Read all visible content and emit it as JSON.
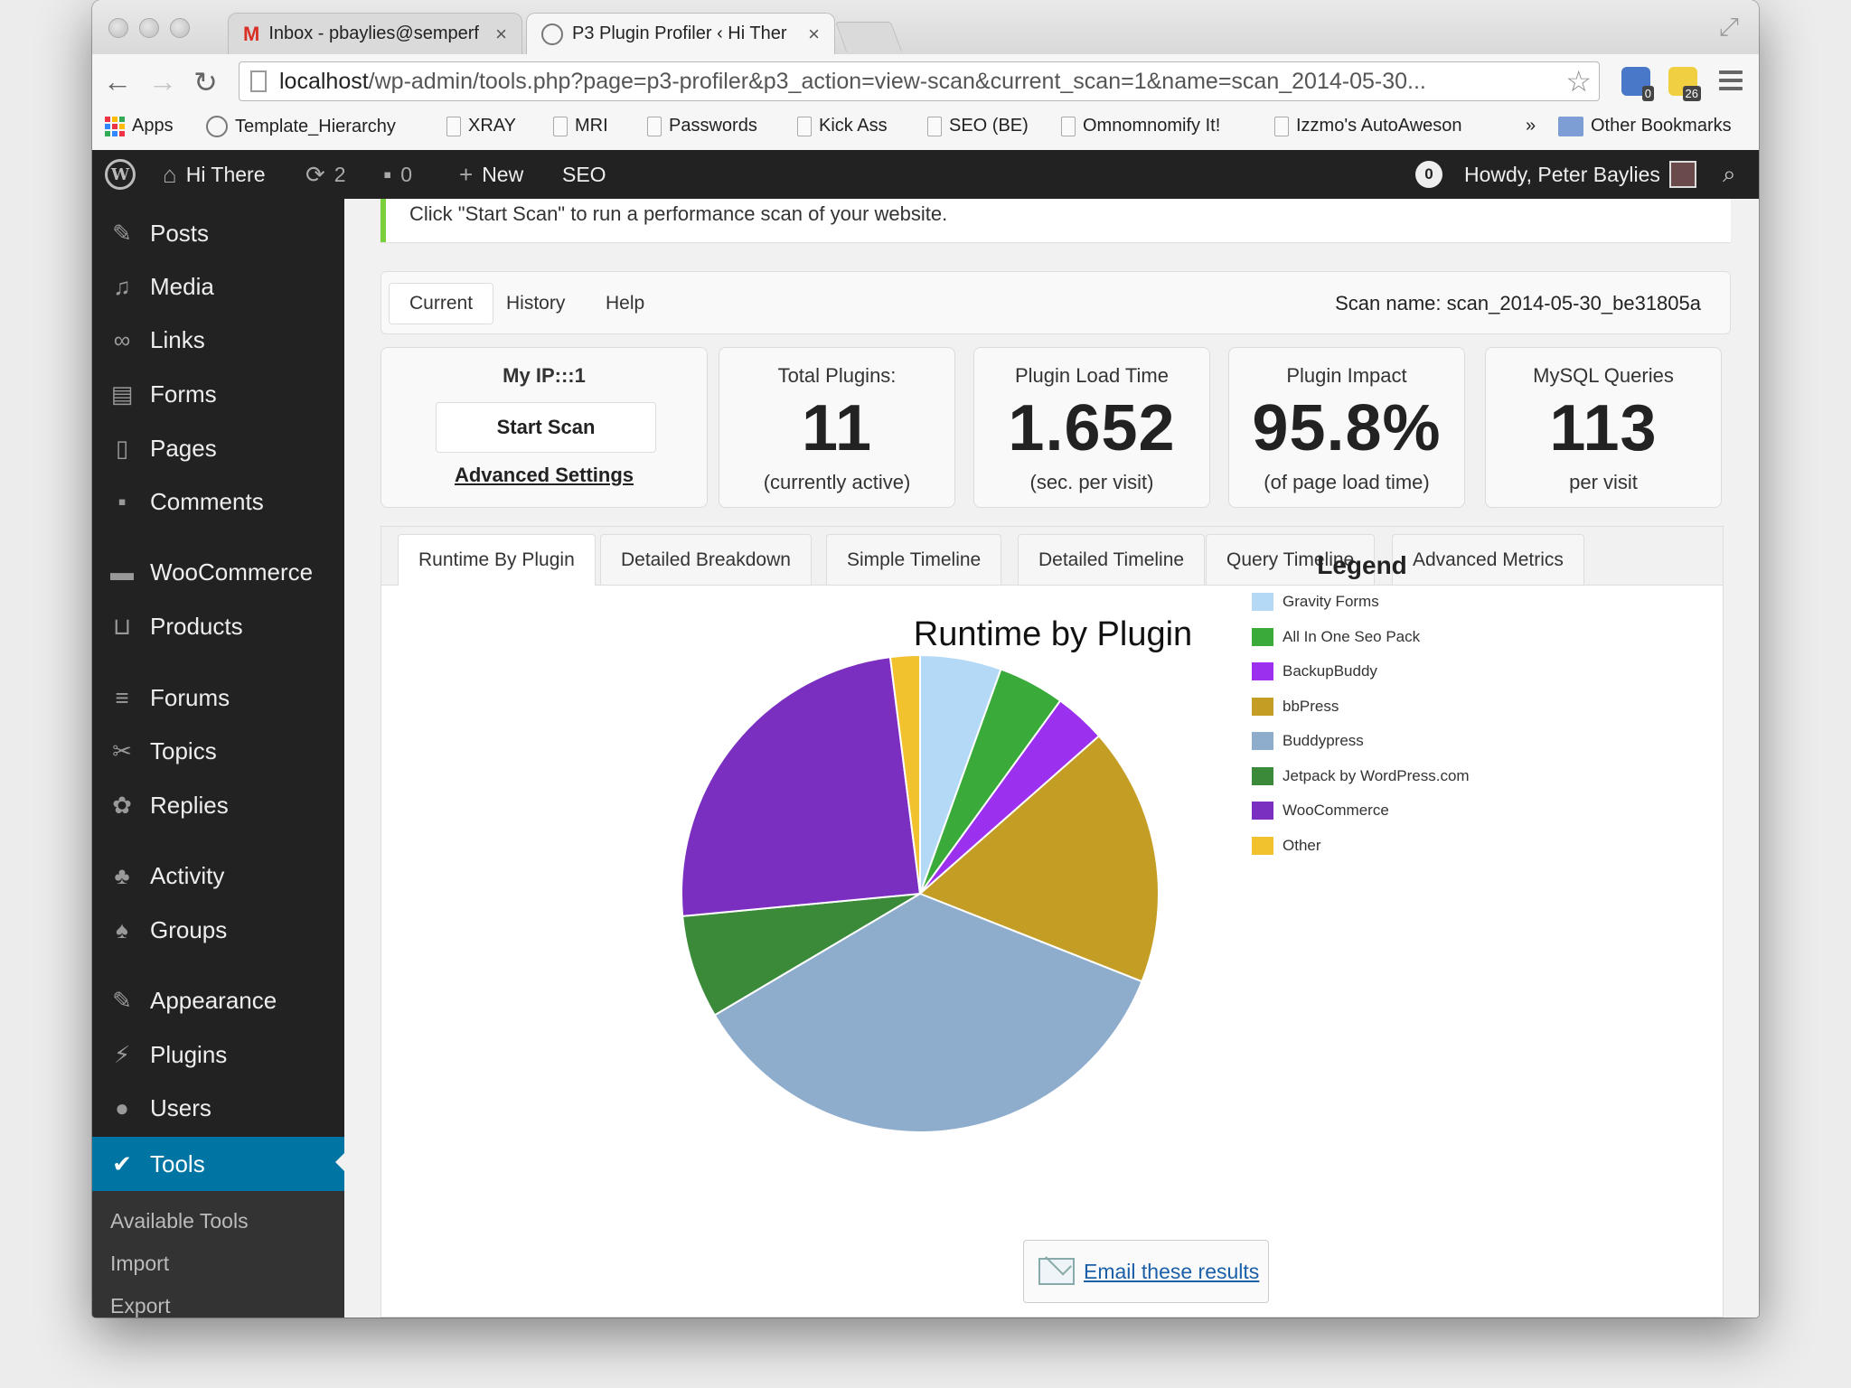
{
  "browser": {
    "tabs": [
      {
        "label": "Inbox - pbaylies@semperf",
        "icon": "gmail-icon"
      },
      {
        "label": "P3 Plugin Profiler ‹ Hi Ther",
        "icon": "globe-icon"
      }
    ],
    "url_host": "localhost",
    "url_path": "/wp-admin/tools.php?page=p3-profiler&p3_action=view-scan&current_scan=1&name=scan_2014-05-30...",
    "extension_badges": [
      "0",
      "26"
    ],
    "bookmarks": [
      "Apps",
      "Template_Hierarchy",
      "XRAY",
      "MRI",
      "Passwords",
      "Kick Ass",
      "SEO (BE)",
      "Omnomnomify It!",
      "Izzmo's AutoAweson",
      "Other Bookmarks"
    ],
    "bookmarks_more": "»"
  },
  "adminbar": {
    "site_name": "Hi There",
    "updates_count": "2",
    "comments_count": "0",
    "new_label": "New",
    "seo_label": "SEO",
    "notification_count": "0",
    "howdy": "Howdy, Peter Baylies"
  },
  "sidebar": {
    "items": [
      {
        "label": "Posts",
        "icon": "pushpin-icon"
      },
      {
        "label": "Media",
        "icon": "media-icon"
      },
      {
        "label": "Links",
        "icon": "link-icon"
      },
      {
        "label": "Forms",
        "icon": "forms-icon"
      },
      {
        "label": "Pages",
        "icon": "pages-icon"
      },
      {
        "label": "Comments",
        "icon": "comment-icon"
      },
      {
        "label": "WooCommerce",
        "icon": "woo-icon"
      },
      {
        "label": "Products",
        "icon": "cart-icon"
      },
      {
        "label": "Forums",
        "icon": "forums-icon"
      },
      {
        "label": "Topics",
        "icon": "topics-icon"
      },
      {
        "label": "Replies",
        "icon": "replies-icon"
      },
      {
        "label": "Activity",
        "icon": "activity-icon"
      },
      {
        "label": "Groups",
        "icon": "groups-icon"
      },
      {
        "label": "Appearance",
        "icon": "brush-icon"
      },
      {
        "label": "Plugins",
        "icon": "plug-icon"
      },
      {
        "label": "Users",
        "icon": "user-icon"
      },
      {
        "label": "Tools",
        "icon": "wrench-icon",
        "active": true
      }
    ],
    "submenu": [
      "Available Tools",
      "Import",
      "Export"
    ]
  },
  "notice": "Click \"Start Scan\" to run a performance scan of your website.",
  "tabs": [
    "Current",
    "History",
    "Help"
  ],
  "scan_name": "Scan name: scan_2014-05-30_be31805a",
  "scan_box": {
    "ip": "My IP:::1",
    "start_label": "Start Scan",
    "advanced_label": "Advanced Settings"
  },
  "stats": [
    {
      "label": "Total Plugins:",
      "value": "11",
      "sub": "(currently active)"
    },
    {
      "label": "Plugin Load Time",
      "value": "1.652",
      "sub": "(sec. per visit)"
    },
    {
      "label": "Plugin Impact",
      "value": "95.8%",
      "sub": "(of page load time)"
    },
    {
      "label": "MySQL Queries",
      "value": "113",
      "sub": "per visit"
    }
  ],
  "chart_tabs": [
    "Runtime By Plugin",
    "Detailed Breakdown",
    "Simple Timeline",
    "Detailed Timeline",
    "Query Timeline",
    "Advanced Metrics"
  ],
  "chart_data": {
    "type": "pie",
    "title": "Runtime by Plugin",
    "legend_title": "Legend",
    "legend_position": "right",
    "series": [
      {
        "name": "Gravity Forms",
        "value": 5.5,
        "color": "#b3d9f7"
      },
      {
        "name": "All In One Seo Pack",
        "value": 4.5,
        "color": "#3aaa3a"
      },
      {
        "name": "BackupBuddy",
        "value": 3.5,
        "color": "#9b30ee"
      },
      {
        "name": "bbPress",
        "value": 17.5,
        "color": "#c49d25"
      },
      {
        "name": "Buddypress",
        "value": 35.5,
        "color": "#8eaccc"
      },
      {
        "name": "Jetpack by WordPress.com",
        "value": 7,
        "color": "#3a8a3a"
      },
      {
        "name": "WooCommerce",
        "value": 24.5,
        "color": "#7b2fc0"
      },
      {
        "name": "Other",
        "value": 2,
        "color": "#f2c12e"
      }
    ]
  },
  "email_label": "Email these results"
}
